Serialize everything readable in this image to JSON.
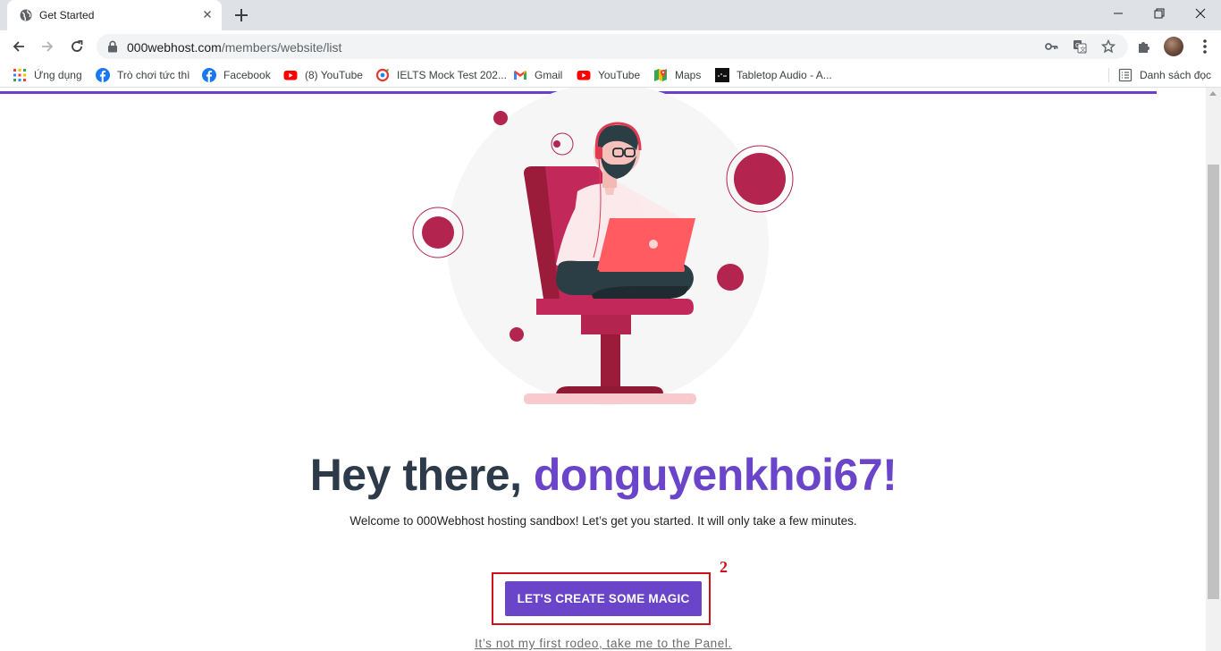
{
  "browser": {
    "tab": {
      "title": "Get Started",
      "favicon": "globe-icon"
    },
    "address": {
      "host": "000webhost.com",
      "path": "/members/website/list"
    },
    "bookmarks": [
      {
        "label": "Ứng dụng",
        "icon": "apps-grid-icon"
      },
      {
        "label": "Trò chơi tức thì",
        "icon": "facebook-icon"
      },
      {
        "label": "Facebook",
        "icon": "facebook-icon"
      },
      {
        "label": "(8) YouTube",
        "icon": "youtube-icon"
      },
      {
        "label": "IELTS Mock Test 202...",
        "icon": "ielts-icon"
      },
      {
        "label": "Gmail",
        "icon": "gmail-icon"
      },
      {
        "label": "YouTube",
        "icon": "youtube-icon"
      },
      {
        "label": "Maps",
        "icon": "maps-icon"
      },
      {
        "label": "Tabletop Audio - A...",
        "icon": "tabletop-audio-icon"
      }
    ],
    "reading_list": {
      "label": "Danh sách đọc",
      "icon": "reading-list-icon"
    }
  },
  "page": {
    "greeting": "Hey there, ",
    "username": "donguyenkhoi67!",
    "subtitle": "Welcome to 000Webhost hosting sandbox! Let’s get you started. It will only take a few minutes.",
    "cta_label": "LET'S CREATE SOME MAGIC",
    "panel_link": "It’s not my first rodeo, take me to the Panel.",
    "annotation_number": "2"
  },
  "colors": {
    "brand_purple": "#6a44c9",
    "heading": "#2d3a4a",
    "annotation_red": "#d0111b",
    "illustration_crimson": "#b3244e"
  }
}
